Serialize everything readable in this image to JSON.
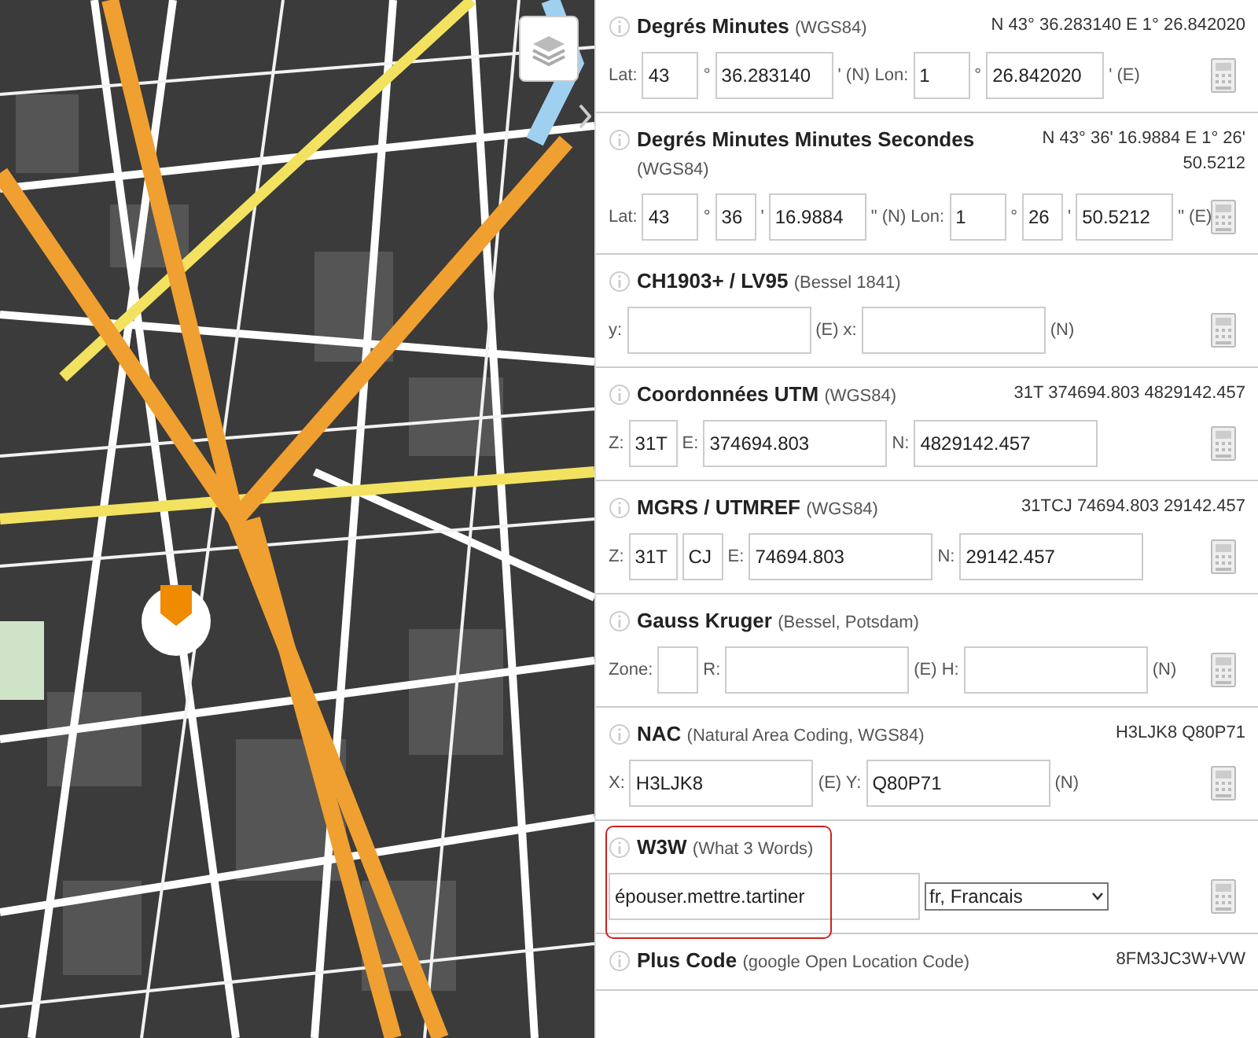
{
  "sections": [
    {
      "title": "Degrés Minutes",
      "subtitle": "(WGS84)",
      "summary": "N 43° 36.283140 E 1° 26.842020",
      "highlighted": false,
      "fields": [
        {
          "kind": "label",
          "text": "Lat:"
        },
        {
          "kind": "degrees",
          "value": "43"
        },
        {
          "kind": "label",
          "text": "°"
        },
        {
          "kind": "decimal",
          "value": "36.283140"
        },
        {
          "kind": "label",
          "text": "' (N) Lon:"
        },
        {
          "kind": "degrees",
          "value": "1"
        },
        {
          "kind": "label",
          "text": "°"
        },
        {
          "kind": "decimal",
          "value": "26.842020"
        },
        {
          "kind": "label",
          "text": "' (E)"
        }
      ]
    },
    {
      "title": "Degrés Minutes Minutes Secondes",
      "subtitle": "(WGS84)",
      "summary": "N 43° 36' 16.9884 E 1° 26' 50.5212",
      "highlighted": false,
      "fields": [
        {
          "kind": "label",
          "text": "Lat:"
        },
        {
          "kind": "degrees",
          "value": "43"
        },
        {
          "kind": "label",
          "text": "°"
        },
        {
          "kind": "minutes",
          "value": "36"
        },
        {
          "kind": "label",
          "text": "'"
        },
        {
          "kind": "seconds",
          "value": "16.9884"
        },
        {
          "kind": "label",
          "text": "\" (N) Lon:"
        },
        {
          "kind": "degrees",
          "value": "1"
        },
        {
          "kind": "label",
          "text": "°"
        },
        {
          "kind": "minutes",
          "value": "26"
        },
        {
          "kind": "label",
          "text": "'"
        },
        {
          "kind": "seconds",
          "value": "50.5212"
        },
        {
          "kind": "label",
          "text": "\" (E)"
        }
      ]
    },
    {
      "title": "CH1903+ / LV95",
      "subtitle": "(Bessel 1841)",
      "highlighted": false,
      "fields": [
        {
          "kind": "label",
          "text": "y:"
        },
        {
          "kind": "coordinate"
        },
        {
          "kind": "label",
          "text": "(E) x:"
        },
        {
          "kind": "coordinate"
        },
        {
          "kind": "label",
          "text": "(N)"
        }
      ]
    },
    {
      "title": "Coordonnées UTM",
      "subtitle": "(WGS84)",
      "summary": "31T 374694.803 4829142.457",
      "highlighted": false,
      "fields": [
        {
          "kind": "label",
          "text": "Z:"
        },
        {
          "kind": "zone",
          "value": "31T"
        },
        {
          "kind": "label",
          "text": "E:"
        },
        {
          "kind": "coordinate",
          "value": "374694.803"
        },
        {
          "kind": "label",
          "text": "N:"
        },
        {
          "kind": "coordinate",
          "value": "4829142.457"
        }
      ]
    },
    {
      "title": "MGRS / UTMREF",
      "subtitle": "(WGS84)",
      "summary": "31TCJ 74694.803 29142.457",
      "highlighted": false,
      "fields": [
        {
          "kind": "label",
          "text": "Z:"
        },
        {
          "kind": "zone",
          "value": "31T"
        },
        {
          "kind": "minutes",
          "value": "CJ"
        },
        {
          "kind": "label",
          "text": "E:"
        },
        {
          "kind": "coordinate",
          "value": "74694.803"
        },
        {
          "kind": "label",
          "text": "N:"
        },
        {
          "kind": "coordinate",
          "value": "29142.457"
        }
      ]
    },
    {
      "title": "Gauss Kruger",
      "subtitle": "(Bessel, Potsdam)",
      "highlighted": false,
      "fields": [
        {
          "kind": "label",
          "text": "Zone:"
        },
        {
          "kind": "minutes"
        },
        {
          "kind": "label",
          "text": "R:"
        },
        {
          "kind": "coordinate"
        },
        {
          "kind": "label",
          "text": "(E) H:"
        },
        {
          "kind": "coordinate"
        },
        {
          "kind": "label",
          "text": "(N)"
        }
      ]
    },
    {
      "title": "NAC",
      "subtitle": "(Natural Area Coding, WGS84)",
      "summary": "H3LJK8 Q80P71",
      "highlighted": false,
      "fields": [
        {
          "kind": "label",
          "text": "X:"
        },
        {
          "kind": "coordinate",
          "value": "H3LJK8"
        },
        {
          "kind": "label",
          "text": "(E) Y:"
        },
        {
          "kind": "coordinate",
          "value": "Q80P71"
        },
        {
          "kind": "label",
          "text": "(N)"
        }
      ]
    },
    {
      "title": "W3W",
      "subtitle": "(What 3 Words)",
      "highlighted": true,
      "fields": [
        {
          "kind": "words",
          "value": "épouser.mettre.tartiner"
        },
        {
          "kind": "select",
          "value": "fr, Francais"
        }
      ]
    },
    {
      "title": "Plus Code",
      "subtitle": "(google Open Location Code)",
      "summary": "8FM3JC3W+VW",
      "highlighted": false
    }
  ]
}
